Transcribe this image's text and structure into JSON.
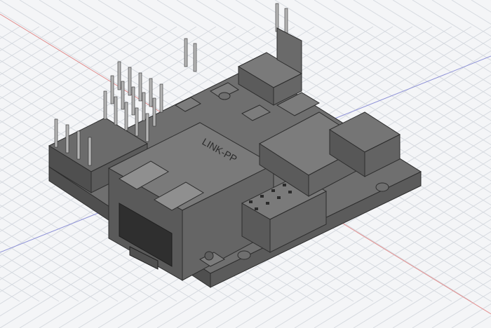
{
  "viewport": {
    "background": "#f4f5f7",
    "grid_color": "#d6dae0",
    "axis_x_color": "#e28f8f",
    "axis_y_color": "#8f93d8"
  },
  "model": {
    "rj45_marking": "LINK-PP",
    "colors": {
      "pcb_top": "#6f6f6f",
      "pcb_side": "#4f4f4f",
      "component_top": "#8a8a8a",
      "component_side": "#5b5b5b",
      "pin_metal": "#b5b5b5",
      "edge": "#2d2d2d"
    }
  }
}
